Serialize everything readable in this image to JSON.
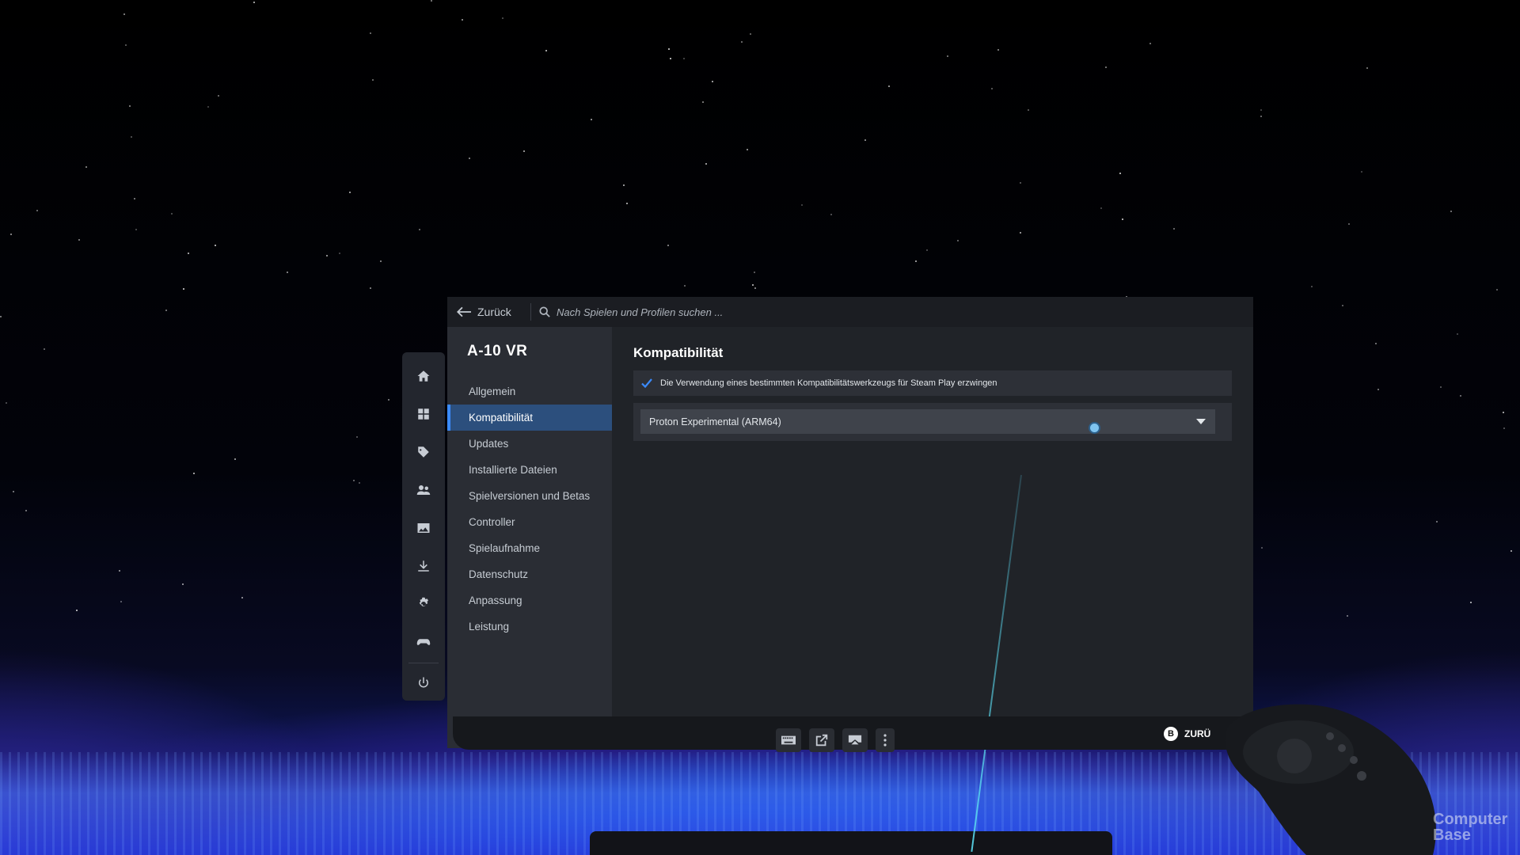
{
  "topbar": {
    "back_label": "Zurück",
    "search_placeholder": "Nach Spielen und Profilen suchen ..."
  },
  "game": {
    "title": "A-10 VR"
  },
  "sidebar": {
    "items": [
      {
        "label": "Allgemein",
        "active": false
      },
      {
        "label": "Kompatibilität",
        "active": true
      },
      {
        "label": "Updates",
        "active": false
      },
      {
        "label": "Installierte Dateien",
        "active": false
      },
      {
        "label": "Spielversionen und Betas",
        "active": false
      },
      {
        "label": "Controller",
        "active": false
      },
      {
        "label": "Spielaufnahme",
        "active": false
      },
      {
        "label": "Datenschutz",
        "active": false
      },
      {
        "label": "Anpassung",
        "active": false
      },
      {
        "label": "Leistung",
        "active": false
      }
    ]
  },
  "rail": {
    "icons": [
      "home-icon",
      "library-grid-icon",
      "store-tag-icon",
      "friends-icon",
      "media-icon",
      "downloads-icon",
      "settings-gear-icon",
      "controller-icon",
      "power-icon"
    ]
  },
  "content": {
    "section_title": "Kompatibilität",
    "force_tool": {
      "checked": true,
      "label": "Die Verwendung eines bestimmten Kompatibilitätswerkzeugs für Steam Play erzwingen"
    },
    "tool_select": {
      "value": "Proton Experimental (ARM64)"
    }
  },
  "footer": {
    "back_hint_button": "B",
    "back_hint_label": "ZURÜ"
  },
  "watermark": {
    "line1": "Computer",
    "line2": "Base"
  },
  "colors": {
    "accent": "#3b8bff",
    "active_bg": "#2c4f7d",
    "sidebar_bg": "#2a2d34",
    "content_bg": "#202328"
  }
}
